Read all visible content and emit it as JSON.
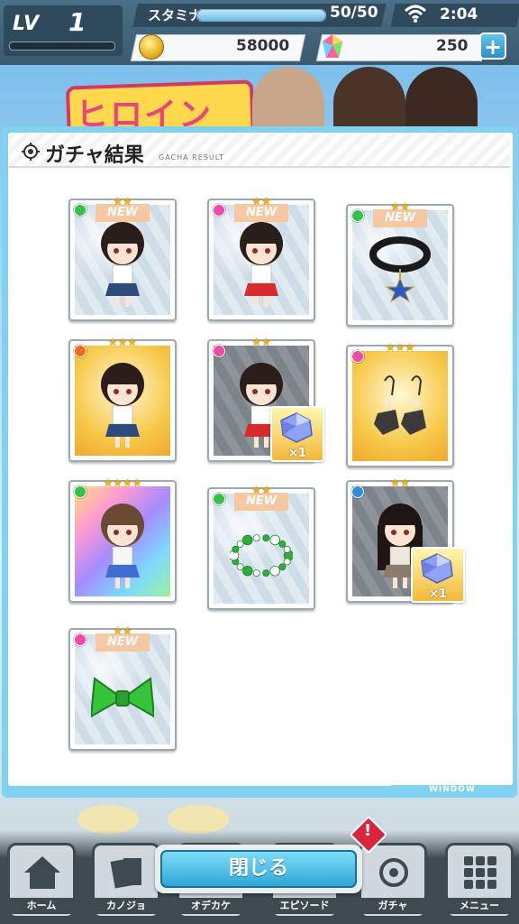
{
  "status": {
    "level_label": "LV",
    "level_value": "1",
    "stamina_label": "スタミナ",
    "stamina_text": "50/50",
    "stamina_fill": 1.0,
    "clock": "2:04",
    "coins": "58000",
    "gems": "250",
    "plus_label": "+"
  },
  "background": {
    "banner_text": "ヒロイン"
  },
  "window": {
    "title": "ガチャ結果",
    "subtitle": "GACHA RESULT",
    "footer": "WINDOW"
  },
  "items": [
    {
      "stars": "★★",
      "new_label": "NEW",
      "type": "character",
      "rarity_color": "#35c24a",
      "frame": "normal"
    },
    {
      "stars": "★★",
      "new_label": "NEW",
      "type": "character-miko",
      "rarity_color": "#ef4aa8",
      "frame": "normal"
    },
    {
      "stars": "★★",
      "new_label": "NEW",
      "type": "choker",
      "rarity_color": "#35c24a",
      "frame": "normal"
    },
    {
      "stars": "★★★",
      "new_label": "",
      "type": "character",
      "rarity_color": "#f26a1b",
      "frame": "gold"
    },
    {
      "stars": "★★",
      "new_label": "",
      "type": "character-miko",
      "rarity_color": "#ef4aa8",
      "frame": "dark",
      "duplicate": "×1"
    },
    {
      "stars": "★★★",
      "new_label": "",
      "type": "earrings",
      "rarity_color": "#ef4aa8",
      "frame": "gold"
    },
    {
      "stars": "★★★★",
      "new_label": "",
      "type": "character-idol",
      "rarity_color": "#35c24a",
      "frame": "rainbow"
    },
    {
      "stars": "★★",
      "new_label": "NEW",
      "type": "bracelet",
      "rarity_color": "#35c24a",
      "frame": "normal"
    },
    {
      "stars": "★★",
      "new_label": "",
      "type": "character-long",
      "rarity_color": "#2e8fd8",
      "frame": "dark",
      "duplicate": "×1"
    },
    {
      "stars": "★★",
      "new_label": "NEW",
      "type": "bow",
      "rarity_color": "#ef4aa8",
      "frame": "normal"
    }
  ],
  "close_button": "閉じる",
  "nav": [
    {
      "label": "ホーム",
      "icon": "home-icon"
    },
    {
      "label": "カノジョ",
      "icon": "cards-icon"
    },
    {
      "label": "オデカケ",
      "icon": "map-icon"
    },
    {
      "label": "エピソード",
      "icon": "book-icon"
    },
    {
      "label": "ガチャ",
      "icon": "gacha-icon"
    },
    {
      "label": "メニュー",
      "icon": "menu-grid-icon"
    }
  ],
  "alert_mark": "!"
}
